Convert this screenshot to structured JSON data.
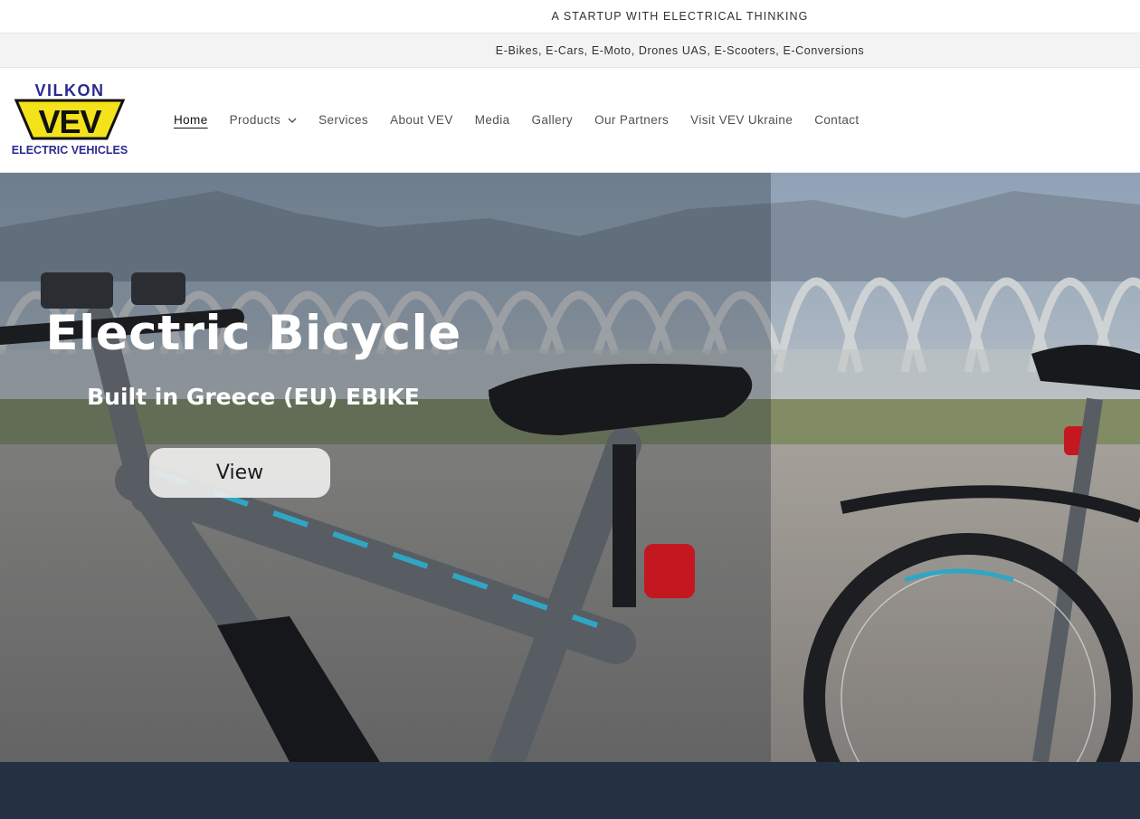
{
  "announcement": {
    "tagline": "A STARTUP WITH ELECTRICAL THINKING",
    "categories": "E-Bikes, E-Cars, E-Moto, Drones UAS, E-Scooters, E-Conversions"
  },
  "header": {
    "logo": {
      "top_text": "VILKON",
      "badge_text": "VEV",
      "bottom_text": "ELECTRIC VEHICLES"
    },
    "nav": [
      {
        "label": "Home",
        "active": true
      },
      {
        "label": "Products",
        "has_dropdown": true
      },
      {
        "label": "Services"
      },
      {
        "label": "About VEV"
      },
      {
        "label": "Media"
      },
      {
        "label": "Gallery"
      },
      {
        "label": "Our Partners"
      },
      {
        "label": "Visit VEV Ukraine"
      },
      {
        "label": "Contact"
      }
    ]
  },
  "hero": {
    "title": "Electric Bicycle",
    "subtitle": "Built in Greece (EU) EBIKE",
    "button_label": "View"
  },
  "colors": {
    "logo_blue": "#2b2a8f",
    "logo_yellow": "#f4e31a",
    "footer_band": "#243142"
  }
}
